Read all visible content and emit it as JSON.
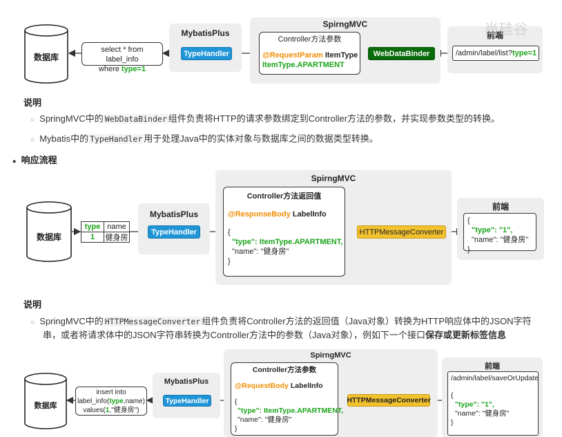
{
  "request_flow": {
    "database_label": "数据库",
    "sql_box": {
      "line1": "select * from label_info",
      "line2_prefix": "where ",
      "line2_key": "type=1"
    },
    "mybatis_title": "MybatisPlus",
    "typehandler_label": "TypeHandler",
    "springmvc_title": "SpirngMVC",
    "controller_title": "Controller方法参数",
    "annotation": "@RequestParam",
    "param_type": " ItemType",
    "enum_value": "ItemType.APARTMENT",
    "binder_label": "WebDataBinder",
    "frontend_title": "前端",
    "url_prefix": "/admin/label/list?",
    "url_param": "type=1"
  },
  "desc1": {
    "heading": "说明",
    "bullet1_pre": "SpringMVC中的",
    "bullet1_code": "WebDataBinder",
    "bullet1_post": "组件负责将HTTP的请求参数绑定到Controller方法的参数，并实现参数类型的转换。",
    "bullet2_pre": "Mybatis中的",
    "bullet2_code": "TypeHandler",
    "bullet2_post": "用于处理Java中的实体对象与数据库之间的数据类型转换。"
  },
  "response_heading": "响应流程",
  "response_flow": {
    "database_label": "数据库",
    "table": {
      "headers": [
        "type",
        "name"
      ],
      "row": [
        "1",
        "健身房"
      ]
    },
    "mybatis_title": "MybatisPlus",
    "typehandler_label": "TypeHandler",
    "springmvc_title": "SpirngMVC",
    "controller_title": "Controller方法返回值",
    "annotation": "@ResponseBody",
    "return_type": " LabelInfo",
    "json_open": "{",
    "json_type_key": "\"type\": ",
    "json_type_val": "ItemType.APARTMENT,",
    "json_name": "\"name\": \"健身房\"",
    "json_close": "}",
    "converter_label": "HTTPMessageConverter",
    "frontend_title": "前端",
    "fe_json_open": "{",
    "fe_json_type": "\"type\": \"1\",",
    "fe_json_name": "\"name\": \"健身房\"",
    "fe_json_close": "}"
  },
  "desc2": {
    "heading": "说明",
    "line1_pre": "SpringMVC中的",
    "line1_code": "HTTPMessageConverter",
    "line1_post": "组件负责将Controller方法的返回值（Java对象）转换为HTTP响应体中的JSON字符",
    "line2_pre": "串，或者将请求体中的JSON字符串转换为Controller方法中的参数（Java对象），例如下一个接口",
    "line2_bold": "保存或更新标签信息"
  },
  "save_flow": {
    "database_label": "数据库",
    "sql_line1": "insert into",
    "sql_line2_pre": "label_info(",
    "sql_line2_key": "type",
    "sql_line2_post": ",name)",
    "sql_line3_pre": "values(",
    "sql_line3_key": "1",
    "sql_line3_post": ",\"健身房\")",
    "mybatis_title": "MybatisPlus",
    "typehandler_label": "TypeHandler",
    "springmvc_title": "SpirngMVC",
    "controller_title": "Controller方法参数",
    "annotation": "@RequestBody",
    "param_type": " LabelInfo",
    "json_open": "{",
    "json_type_key": "\"type\": ",
    "json_type_val": "ItemType.APARTMENT,",
    "json_name": "\"name\": \"健身房\"",
    "json_close": "}",
    "converter_label": "HTTPMessageConverter",
    "frontend_title": "前端",
    "url": "/admin/label/saveOrUpdate",
    "fe_json_open": "{",
    "fe_json_type": "\"type\": \"1\",",
    "fe_json_name": "\"name\": \"健身房\"",
    "fe_json_close": "}"
  },
  "watermark": "尚硅谷"
}
